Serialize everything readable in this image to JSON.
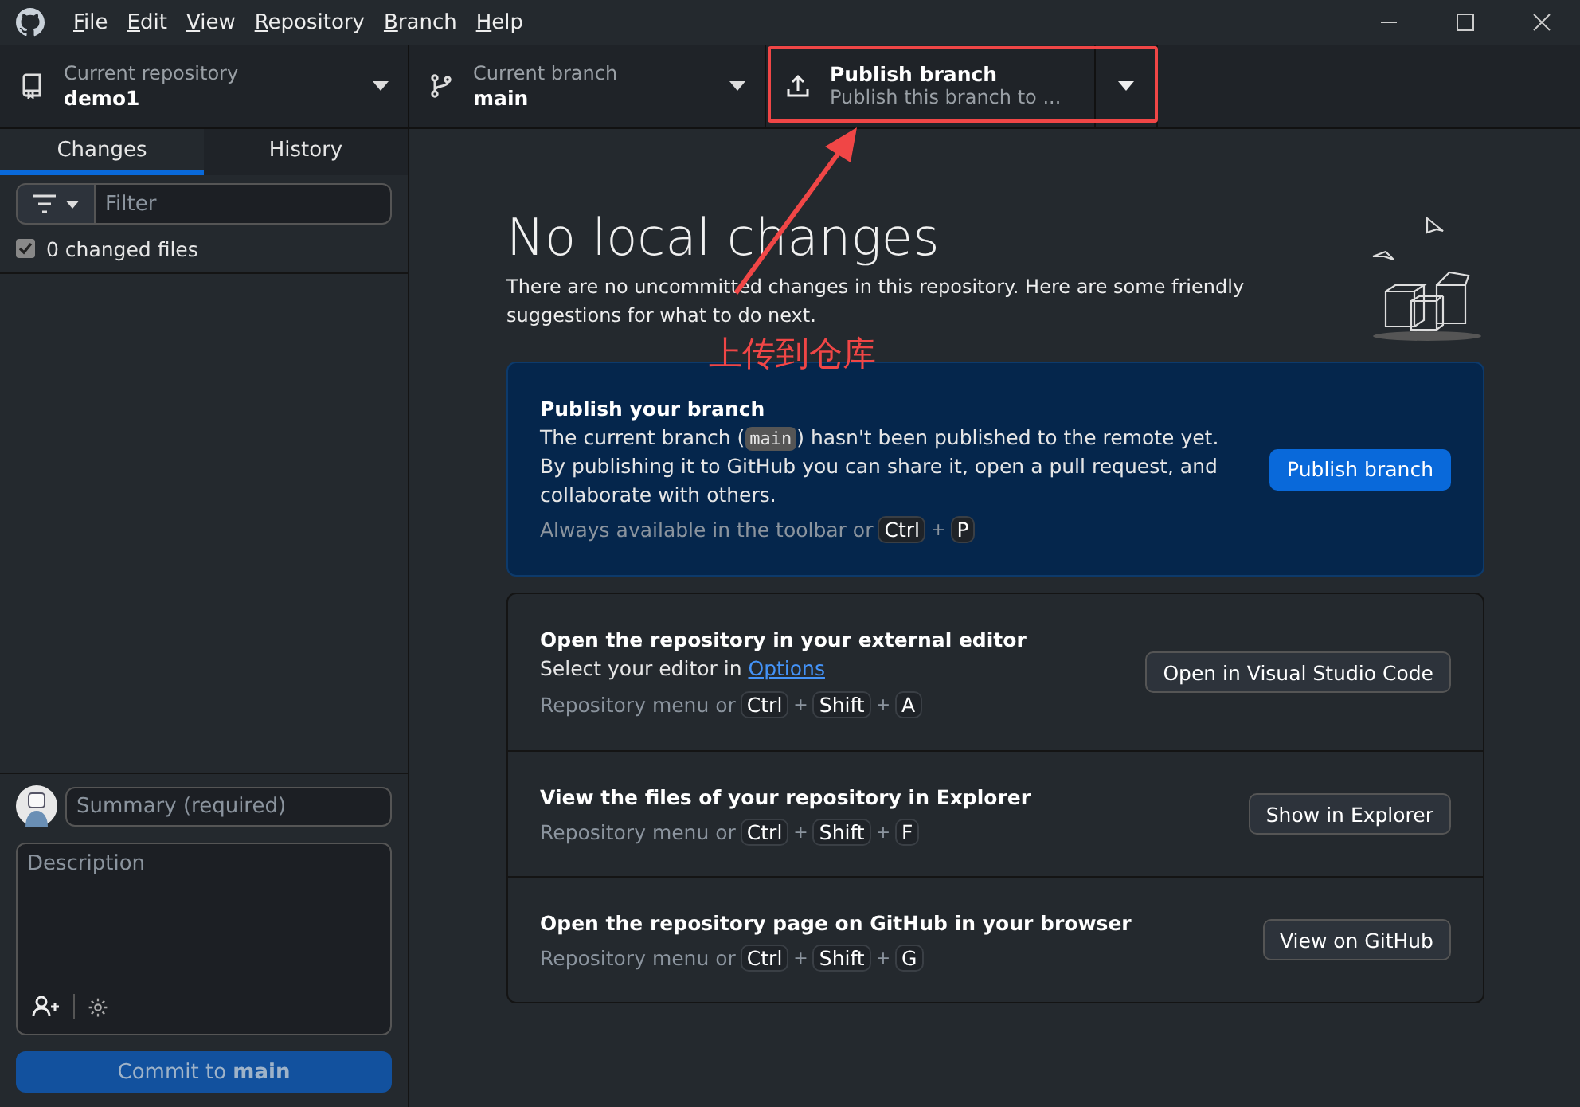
{
  "menu": [
    {
      "label": "File"
    },
    {
      "label": "Edit"
    },
    {
      "label": "View"
    },
    {
      "label": "Repository"
    },
    {
      "label": "Branch"
    },
    {
      "label": "Help"
    }
  ],
  "toolbar": {
    "repository": {
      "caption": "Current repository",
      "value": "demo1"
    },
    "branch": {
      "caption": "Current branch",
      "value": "main"
    },
    "publish": {
      "title": "Publish branch",
      "subtitle": "Publish this branch to ..."
    }
  },
  "tabs": [
    {
      "label": "Changes",
      "selected": true
    },
    {
      "label": "History",
      "selected": false
    }
  ],
  "filter": {
    "placeholder": "Filter"
  },
  "changed_files": {
    "label": "0 changed files",
    "checked": true
  },
  "commit": {
    "summary_placeholder": "Summary (required)",
    "description_placeholder": "Description",
    "button_before": "Commit to",
    "button_branch": "main",
    "disabled": true
  },
  "main": {
    "heading": "No local changes",
    "intro": "There are no uncommitted changes in this repository. Here are some friendly suggestions for what to do next.",
    "publish_card": {
      "title": "Publish your branch",
      "body_before": "The current branch (",
      "branch": "main",
      "body_after": ") hasn't been published to the remote yet. By publishing it to GitHub you can share it, open a pull request, and collaborate with others.",
      "hint": "Always available in the toolbar or",
      "keys": [
        "Ctrl",
        "P"
      ],
      "separator": "+",
      "button": "Publish branch"
    },
    "actions": [
      {
        "title": "Open the repository in your external editor",
        "subtitle_before": "Select your editor in",
        "subtitle_link": "Options",
        "hint": "Repository menu or",
        "keys": [
          "Ctrl",
          "Shift",
          "A"
        ],
        "separator": "+",
        "button": "Open in Visual Studio Code"
      },
      {
        "title": "View the files of your repository in Explorer",
        "hint": "Repository menu or",
        "keys": [
          "Ctrl",
          "Shift",
          "F"
        ],
        "separator": "+",
        "button": "Show in Explorer"
      },
      {
        "title": "Open the repository page on GitHub in your browser",
        "hint": "Repository menu or",
        "keys": [
          "Ctrl",
          "Shift",
          "G"
        ],
        "separator": "+",
        "button": "View on GitHub"
      }
    ]
  },
  "annotation": {
    "text": "上传到仓库"
  }
}
